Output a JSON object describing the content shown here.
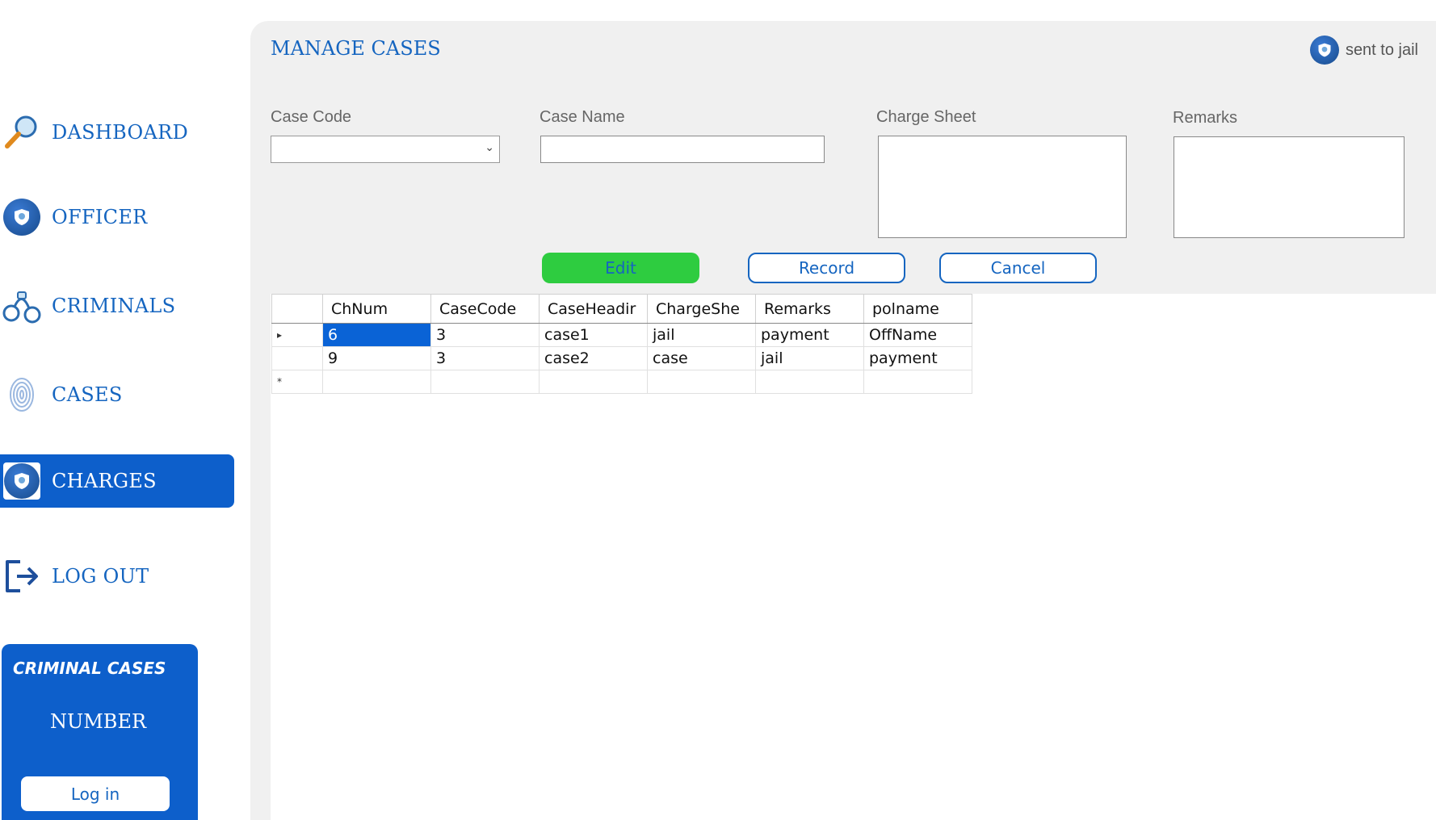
{
  "sidebar": {
    "items": [
      {
        "label": "DASHBOARD",
        "icon": "magnifier-icon"
      },
      {
        "label": "OFFICER",
        "icon": "police-badge-icon"
      },
      {
        "label": "CRIMINALS",
        "icon": "handcuffs-icon"
      },
      {
        "label": "CASES",
        "icon": "fingerprint-icon"
      },
      {
        "label": "CHARGES",
        "icon": "police-badge-icon",
        "active": true
      },
      {
        "label": "LOG OUT",
        "icon": "logout-icon"
      }
    ],
    "stats": {
      "title": "CRIMINAL CASES",
      "number_label": "NUMBER",
      "button_label": "Log in"
    }
  },
  "header": {
    "title": "MANAGE CASES",
    "user_label": "sent to jail"
  },
  "form": {
    "case_code_label": "Case Code",
    "case_code_value": "",
    "case_name_label": "Case Name",
    "case_name_value": "",
    "charge_sheet_label": "Charge Sheet",
    "charge_sheet_value": "",
    "remarks_label": "Remarks",
    "remarks_value": ""
  },
  "actions": {
    "edit": "Edit",
    "record": "Record",
    "cancel": "Cancel"
  },
  "grid": {
    "columns": [
      "ChNum",
      "CaseCode",
      "CaseHeadir",
      "ChargeShe",
      "Remarks",
      "polname"
    ],
    "rows": [
      [
        "6",
        "3",
        "case1",
        "jail",
        "payment",
        "OffName"
      ],
      [
        "9",
        "3",
        "case2",
        "case",
        "jail",
        "payment"
      ]
    ],
    "current_row_marker": "▸",
    "new_row_marker": "*"
  },
  "colors": {
    "accent": "#1565c0",
    "active_nav": "#0d5fcb",
    "edit_button": "#2ecc40",
    "panel": "#f0f0f0"
  }
}
